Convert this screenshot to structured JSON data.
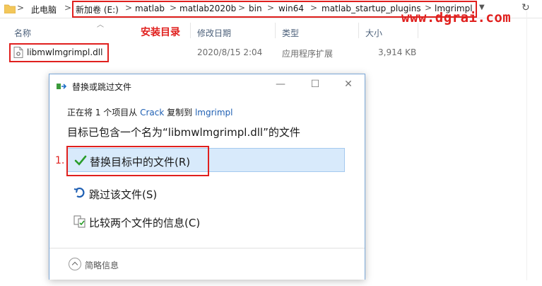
{
  "address_bar": {
    "root": "此电脑",
    "crumbs": [
      "新加卷 (E:)",
      "matlab",
      "matlab2020b",
      "bin",
      "win64",
      "matlab_startup_plugins",
      "lmgrimpl"
    ],
    "separator": ">"
  },
  "watermark": "www.dgrai.com",
  "columns": {
    "name": "名称",
    "modified": "修改日期",
    "type": "类型",
    "size": "大小"
  },
  "annotations": {
    "install_dir": "安装目录",
    "step_1": "1."
  },
  "file": {
    "name": "libmwlmgrimpl.dll",
    "modified": "2020/8/15 2:04",
    "type": "应用程序扩展",
    "size": "3,914 KB"
  },
  "dialog": {
    "title": "替换或跳过文件",
    "sub_prefix": "正在将 1 个项目从 ",
    "sub_source": "Crack",
    "sub_middle": " 复制到 ",
    "sub_dest": "lmgrimpl",
    "heading": "目标已包含一个名为“libmwlmgrimpl.dll”的文件",
    "options": [
      {
        "label": "替换目标中的文件(R)",
        "icon": "checkmark-icon"
      },
      {
        "label": "跳过该文件(S)",
        "icon": "skip-arrow-icon"
      },
      {
        "label": "比较两个文件的信息(C)",
        "icon": "compare-files-icon"
      }
    ],
    "footer": "简略信息"
  },
  "colors": {
    "annotation_red": "#e0201e",
    "link_blue": "#1e5fb3",
    "highlight": "#d8eafb",
    "check_green": "#2a9d2a"
  }
}
